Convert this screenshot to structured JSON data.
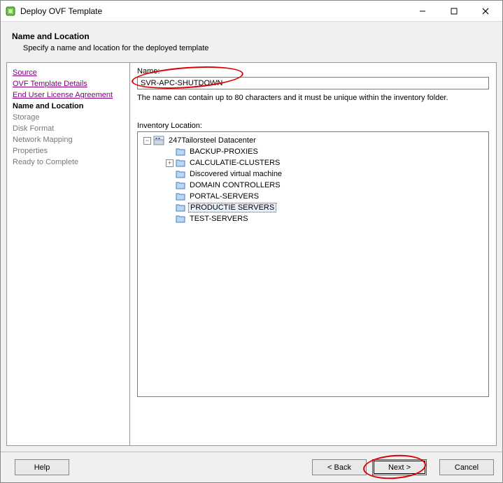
{
  "window": {
    "title": "Deploy OVF Template"
  },
  "header": {
    "title": "Name and Location",
    "subtitle": "Specify a name and location for the deployed template"
  },
  "sidebar": {
    "steps": [
      {
        "label": "Source",
        "state": "visited"
      },
      {
        "label": "OVF Template Details",
        "state": "visited"
      },
      {
        "label": "End User License Agreement",
        "state": "visited"
      },
      {
        "label": "Name and Location",
        "state": "current"
      },
      {
        "label": "Storage",
        "state": "future"
      },
      {
        "label": "Disk Format",
        "state": "future"
      },
      {
        "label": "Network Mapping",
        "state": "future"
      },
      {
        "label": "Properties",
        "state": "future"
      },
      {
        "label": "Ready to Complete",
        "state": "future"
      }
    ]
  },
  "main": {
    "name_label": "Name:",
    "name_value": "SVR-APC-SHUTDOWN",
    "name_hint": "The name can contain up to 80 characters and it must be unique within the inventory folder.",
    "inv_label": "Inventory Location:",
    "tree": {
      "root": "247Tailorsteel Datacenter",
      "children": [
        {
          "label": "BACKUP-PROXIES",
          "expandable": false
        },
        {
          "label": "CALCULATIE-CLUSTERS",
          "expandable": true
        },
        {
          "label": "Discovered virtual machine",
          "expandable": false
        },
        {
          "label": "DOMAIN CONTROLLERS",
          "expandable": false
        },
        {
          "label": "PORTAL-SERVERS",
          "expandable": false
        },
        {
          "label": "PRODUCTIE SERVERS",
          "expandable": false,
          "selected": true
        },
        {
          "label": "TEST-SERVERS",
          "expandable": false
        }
      ]
    }
  },
  "footer": {
    "help": "Help",
    "back": "< Back",
    "next": "Next >",
    "cancel": "Cancel"
  }
}
